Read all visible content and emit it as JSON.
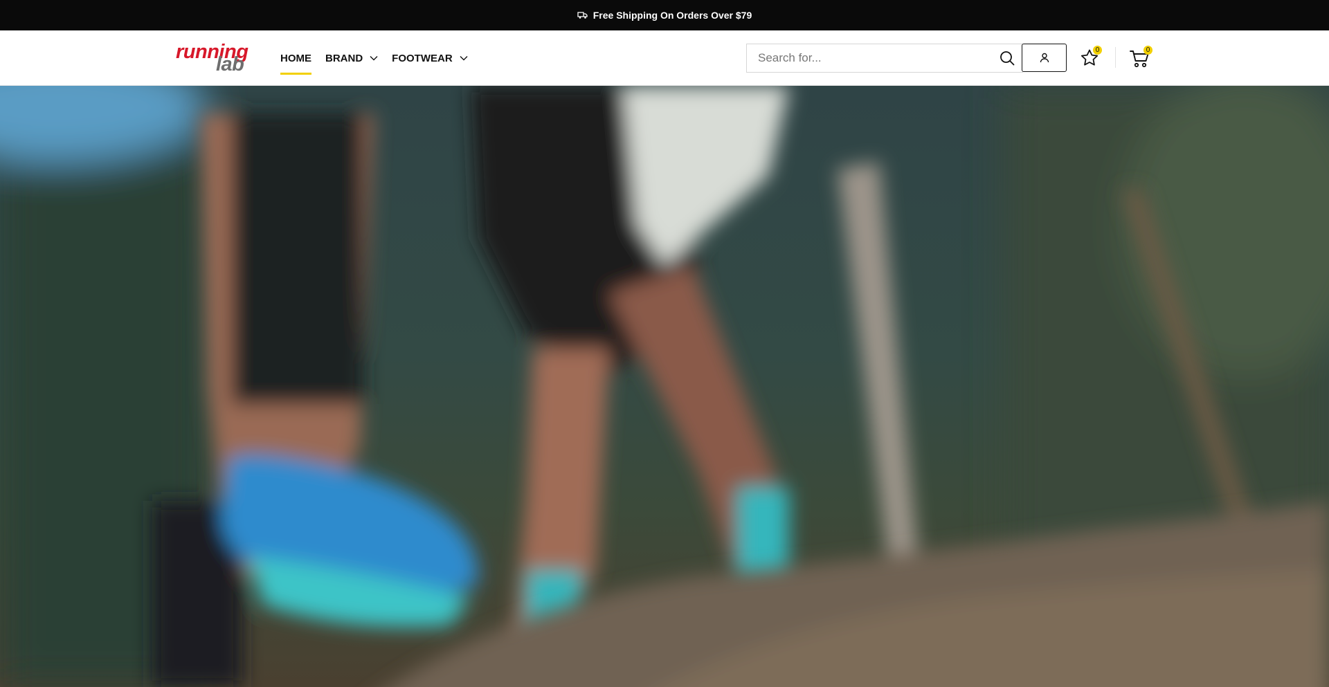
{
  "announcement": {
    "text": "Free Shipping On Orders Over $79",
    "icon": "truck-icon"
  },
  "header": {
    "logo": {
      "line1": "running",
      "line2": "lab"
    },
    "nav": [
      {
        "label": "HOME",
        "active": true,
        "dropdown": false
      },
      {
        "label": "BRAND",
        "active": false,
        "dropdown": true
      },
      {
        "label": "FOOTWEAR",
        "active": false,
        "dropdown": true
      }
    ],
    "search": {
      "placeholder": "Search for...",
      "value": ""
    },
    "wishlist": {
      "icon": "star-icon",
      "count": "0"
    },
    "cart": {
      "icon": "cart-icon",
      "count": "0"
    },
    "account": {
      "icon": "user-icon"
    }
  },
  "colors": {
    "brand_red": "#d7182a",
    "accent_yellow": "#f2d000",
    "announcement_bg": "#0a0a0a"
  }
}
